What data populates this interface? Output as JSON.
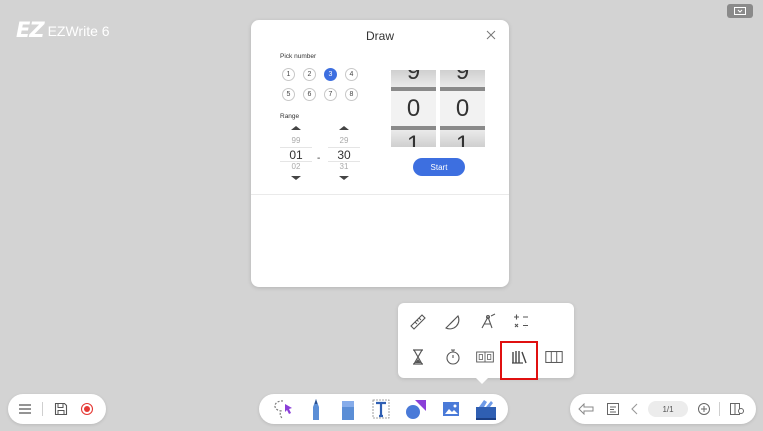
{
  "app": {
    "logo_mark": "EZ",
    "name": "EZWrite 6"
  },
  "dialog": {
    "title": "Draw",
    "pick_label": "Pick number",
    "pick_numbers": [
      "1",
      "2",
      "3",
      "4",
      "5",
      "6",
      "7",
      "8"
    ],
    "pick_selected": "3",
    "range_label": "Range",
    "range_from": {
      "above": "99",
      "current": "01",
      "below": "02"
    },
    "range_to": {
      "above": "29",
      "current": "30",
      "below": "31"
    },
    "range_separator": "-",
    "drums": [
      {
        "above": "9",
        "current": "0",
        "below": "1"
      },
      {
        "above": "9",
        "current": "0",
        "below": "1"
      }
    ],
    "start_label": "Start"
  },
  "tools_popup": {
    "row1": [
      "ruler-icon",
      "protractor-icon",
      "compass-icon",
      "calculator-icon"
    ],
    "row2": [
      "hourglass-icon",
      "stopwatch-icon",
      "scoreboard-icon",
      "draw-lots-icon",
      "panel-icon"
    ],
    "highlighted": "draw-lots-icon"
  },
  "bottom_center": [
    "lasso-select-icon",
    "pen-icon",
    "eraser-icon",
    "text-icon",
    "shapes-icon",
    "image-icon",
    "toolbox-icon"
  ],
  "pager": {
    "current": "1/1"
  },
  "colors": {
    "accent": "#3d6fe0",
    "highlight": "#e01010",
    "record": "#e53935"
  }
}
